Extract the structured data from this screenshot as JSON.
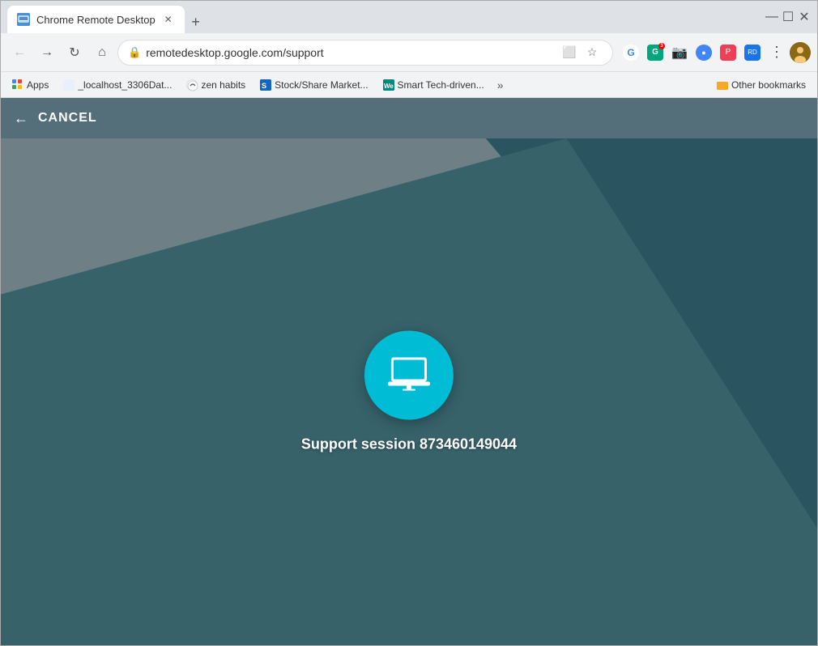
{
  "browser": {
    "tab": {
      "title": "Chrome Remote Desktop",
      "favicon_color": "#4a90d9"
    },
    "address": "remotedesktop.google.com/support",
    "window_controls": {
      "minimize": "—",
      "maximize": "☐",
      "close": "✕"
    }
  },
  "bookmarks": {
    "items": [
      {
        "label": "Apps",
        "type": "grid"
      },
      {
        "label": "_localhost_3306Dat...",
        "type": "site"
      },
      {
        "label": "zen habits",
        "type": "site"
      },
      {
        "label": "Stock/Share Market...",
        "type": "site"
      },
      {
        "label": "Smart Tech-driven...",
        "type": "site"
      }
    ],
    "more_label": "»",
    "folder_label": "Other bookmarks"
  },
  "app": {
    "header": {
      "cancel_label": "CANCEL",
      "back_arrow": "←"
    },
    "main": {
      "session_label": "Support session 873460149044",
      "laptop_icon": "laptop"
    }
  }
}
